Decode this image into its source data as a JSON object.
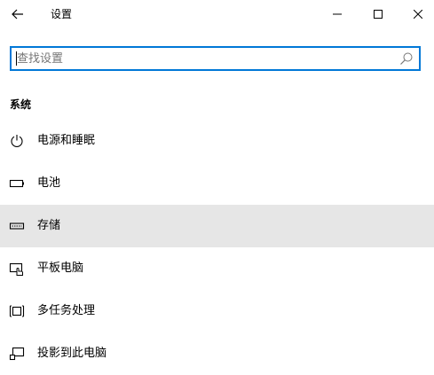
{
  "window": {
    "title": "设置"
  },
  "search": {
    "placeholder": "查找设置",
    "value": ""
  },
  "section": {
    "heading": "系统"
  },
  "nav": {
    "items": [
      {
        "label": "电源和睡眠",
        "icon": "power-icon",
        "selected": false
      },
      {
        "label": "电池",
        "icon": "battery-icon",
        "selected": false
      },
      {
        "label": "存储",
        "icon": "storage-icon",
        "selected": true
      },
      {
        "label": "平板电脑",
        "icon": "tablet-mode-icon",
        "selected": false
      },
      {
        "label": "多任务处理",
        "icon": "multitasking-icon",
        "selected": false
      },
      {
        "label": "投影到此电脑",
        "icon": "projecting-icon",
        "selected": false
      }
    ]
  },
  "colors": {
    "accent": "#0078d7",
    "selected_bg": "#e6e6e6"
  }
}
